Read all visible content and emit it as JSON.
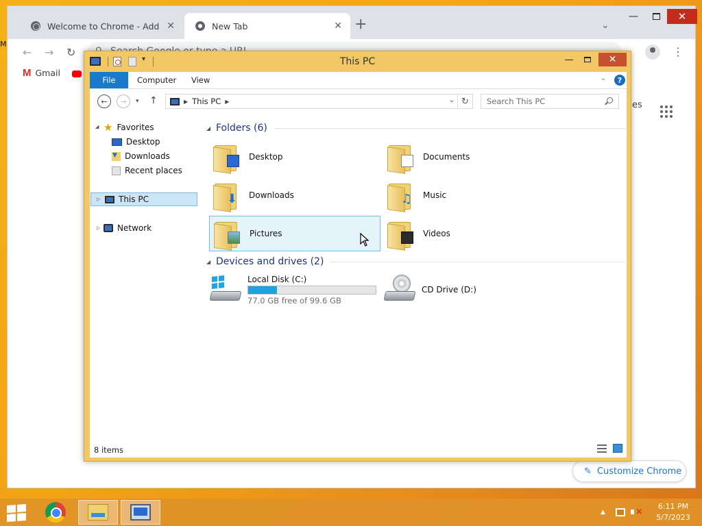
{
  "desktop": {
    "edge_text": "M"
  },
  "chrome": {
    "tabs": [
      {
        "title": "Welcome to Chrome - Add book",
        "close": "✕"
      },
      {
        "title": "New Tab",
        "close": "✕"
      }
    ],
    "new_tab": "+",
    "tab_search": "⌄",
    "window_controls": {
      "minimize": "—",
      "close": "✕"
    },
    "omnibox_placeholder": "Search Google or type a URL",
    "bookmarks": [
      {
        "icon": "gmail-icon",
        "label": "Gmail"
      },
      {
        "icon": "youtube-icon",
        "label": ""
      }
    ],
    "shortcuts_fragment": "es",
    "customize_label": "Customize Chrome",
    "customize_icon": "✎"
  },
  "explorer": {
    "title": "This PC",
    "window_controls": {
      "minimize": "—",
      "close": "✕"
    },
    "ribbon_tabs": [
      "File",
      "Computer",
      "View"
    ],
    "ribbon_chevron": "⌄",
    "help": "?",
    "address_path": "This PC",
    "address_arrow": "▶",
    "search_placeholder": "Search This PC",
    "nav_pane": {
      "favorites_label": "Favorites",
      "favorites": [
        {
          "label": "Desktop",
          "icon": "desktop-icon"
        },
        {
          "label": "Downloads",
          "icon": "downloads-icon"
        },
        {
          "label": "Recent places",
          "icon": "recent-places-icon"
        }
      ],
      "this_pc": "This PC",
      "network": "Network"
    },
    "groups": {
      "folders_title": "Folders (6)",
      "drives_title": "Devices and drives (2)"
    },
    "folders": [
      {
        "label": "Desktop",
        "icon": "desktop-folder-icon"
      },
      {
        "label": "Documents",
        "icon": "documents-folder-icon"
      },
      {
        "label": "Downloads",
        "icon": "downloads-folder-icon"
      },
      {
        "label": "Music",
        "icon": "music-folder-icon"
      },
      {
        "label": "Pictures",
        "icon": "pictures-folder-icon",
        "hovered": true
      },
      {
        "label": "Videos",
        "icon": "videos-folder-icon"
      }
    ],
    "drives": [
      {
        "name": "Local Disk (C:)",
        "free_text": "77.0 GB free of 99.6 GB",
        "used_fraction": 0.227
      },
      {
        "name": "CD Drive (D:)"
      }
    ],
    "status_text": "8 items"
  },
  "taskbar": {
    "apps": [
      "chrome-icon",
      "file-explorer-icon",
      "remote-desktop-icon"
    ],
    "tray_chevron": "▲",
    "time": "6:11 PM",
    "date": "5/7/2023"
  }
}
